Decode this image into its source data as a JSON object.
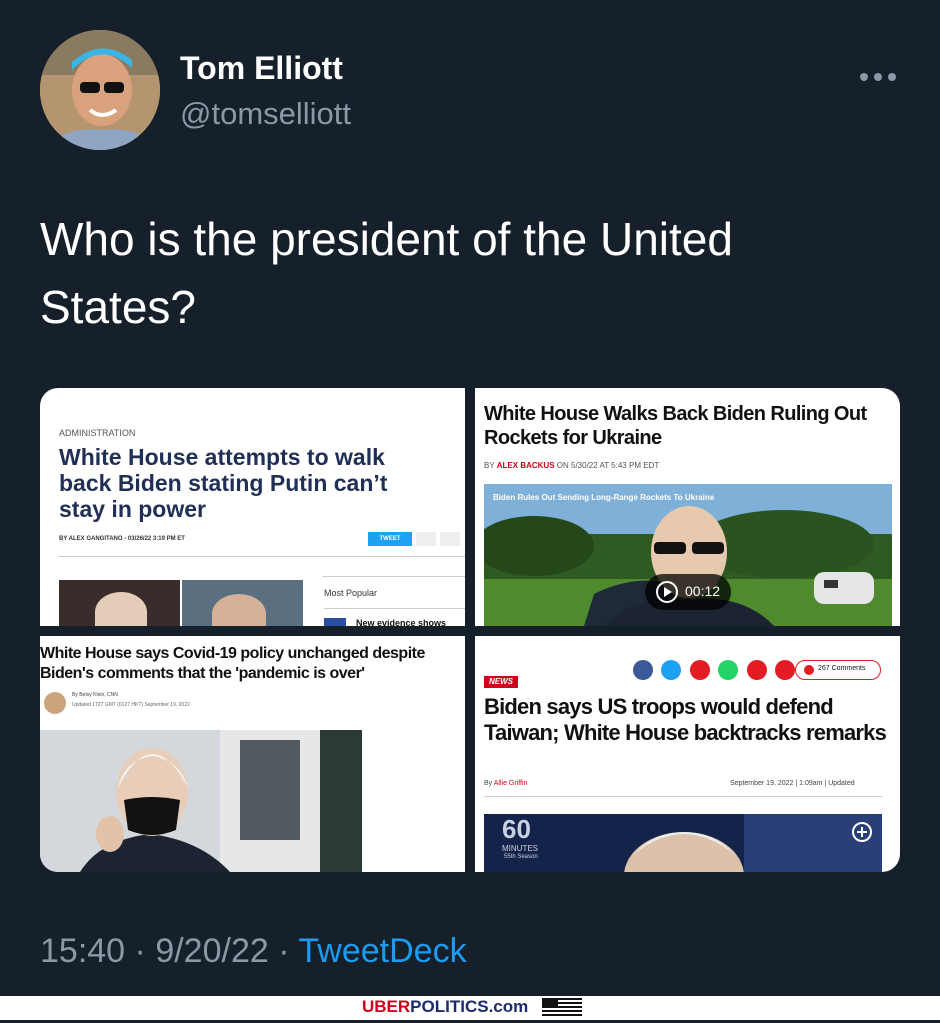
{
  "tweet": {
    "author_name": "Tom Elliott",
    "author_handle": "@tomselliott",
    "more_icon": "…",
    "text": "Who is the president of the United States?",
    "time": "15:40",
    "sep1": "·",
    "date": "9/20/22",
    "sep2": "·",
    "source": "TweetDeck"
  },
  "images": [
    {
      "section": "ADMINISTRATION",
      "headline": "White House attempts to walk back Biden stating Putin can’t stay in power",
      "byline": "BY ALEX GANGITANO - 03/26/22 3:19 PM ET",
      "share_tweet": "TWEET",
      "sidebar_title": "Most Popular",
      "sidebar_snippet": "New evidence shows"
    },
    {
      "headline": "White House Walks Back Biden Ruling Out Rockets for Ukraine",
      "byline_by": "BY",
      "byline_author": "ALEX BACKUS",
      "byline_date": "ON 5/30/22 AT 5:43 PM EDT",
      "video_caption": "Biden Rules Out Sending Long-Range Rockets To Ukraine",
      "video_duration": "00:12"
    },
    {
      "headline": "White House says Covid-19 policy unchanged despite Biden's comments that the 'pandemic is over'",
      "byline": "By Betsy Klein, CNN",
      "updated": "Updated 1727 GMT (0127 HKT) September 19, 2022"
    },
    {
      "badge": "NEWS",
      "comments": "267 Comments",
      "headline": "Biden says US troops would defend Taiwan; White House backtracks remarks",
      "byline_by": "By",
      "byline_author": "Allie Griffin",
      "date": "September 19, 2022 | 1:09am | Updated",
      "logo_top": "60",
      "logo_mid": "MINUTES",
      "logo_bottom": "55th Season"
    }
  ],
  "watermark": {
    "part1": "UBER",
    "part2": "POLITICS",
    "part3": ".com"
  }
}
